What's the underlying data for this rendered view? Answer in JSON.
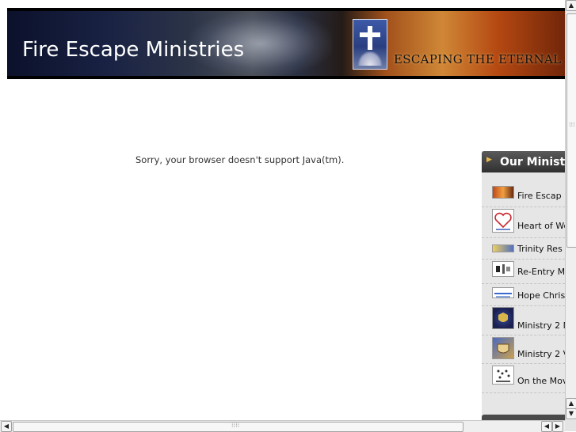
{
  "banner": {
    "title": "Fire Escape Ministries",
    "tagline": "ESCAPING THE ETERNAL"
  },
  "main": {
    "java_message": "Sorry, your browser doesn't support Java(tm)."
  },
  "ministries": {
    "header": "Our Ministr",
    "items": [
      {
        "label": "Fire Escap",
        "icon": "fire-escape-logo"
      },
      {
        "label": "Heart of Wo",
        "icon": "heart-logo"
      },
      {
        "label": "Trinity Res",
        "icon": "trinity-logo"
      },
      {
        "label": "Re-Entry M",
        "icon": "re-entry-logo"
      },
      {
        "label": "Hope Christ",
        "icon": "hope-logo"
      },
      {
        "label": "Ministry 2 M",
        "icon": "badge-logo"
      },
      {
        "label": "Ministry 2 V",
        "icon": "shield-logo"
      },
      {
        "label": "On the Mov",
        "icon": "footprints-logo"
      }
    ]
  },
  "scrollbars": {
    "up": "▲",
    "down": "▼",
    "left": "◀",
    "right": "▶"
  },
  "colors": {
    "panel_bg": "#e6e6e6",
    "header_bg": "#3a3a3a",
    "header_arrow": "#e8b84a",
    "banner_bg": "#000000"
  }
}
